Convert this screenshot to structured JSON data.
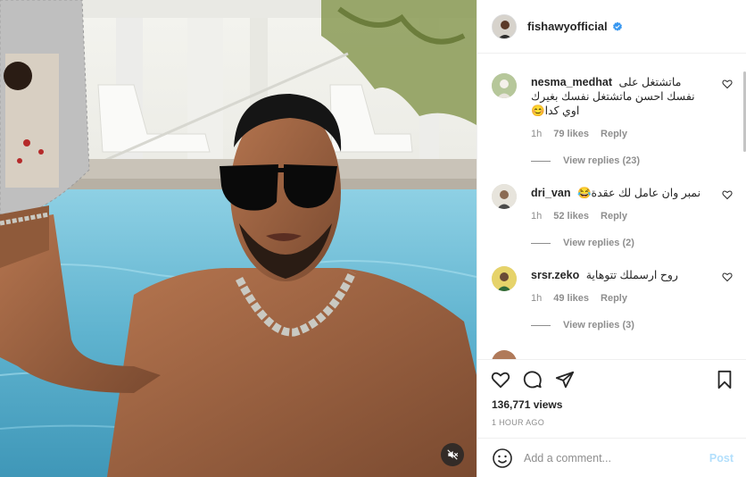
{
  "header": {
    "username": "fishawyofficial",
    "verified": true
  },
  "comments": [
    {
      "username": "nesma_medhat",
      "text": "ماتشتغل على نفسك احسن ماتشتغل نفسك بغيرك اوي كدا😊",
      "time": "1h",
      "likes": "79 likes",
      "reply": "Reply",
      "view_replies": "View replies (23)"
    },
    {
      "username": "dri_van",
      "text": "نمبر وان عامل لك عقدة😂",
      "time": "1h",
      "likes": "52 likes",
      "reply": "Reply",
      "view_replies": "View replies (2)"
    },
    {
      "username": "srsr.zeko",
      "text": "روح ارسملك تتوهاية",
      "time": "1h",
      "likes": "49 likes",
      "reply": "Reply",
      "view_replies": "View replies (3)"
    }
  ],
  "post": {
    "views": "136,771 views",
    "time": "1 HOUR AGO"
  },
  "add_comment": {
    "placeholder": "Add a comment...",
    "post_label": "Post"
  },
  "icons": {
    "like": "heart-icon",
    "comment": "comment-icon",
    "share": "share-icon",
    "save": "bookmark-icon",
    "mute": "muted-speaker-icon",
    "emoji": "emoji-icon",
    "verified": "verified-badge-icon"
  },
  "colors": {
    "verified": "#3897f0",
    "post_disabled": "#b2dffc",
    "muted_text": "#8e8e8e"
  }
}
